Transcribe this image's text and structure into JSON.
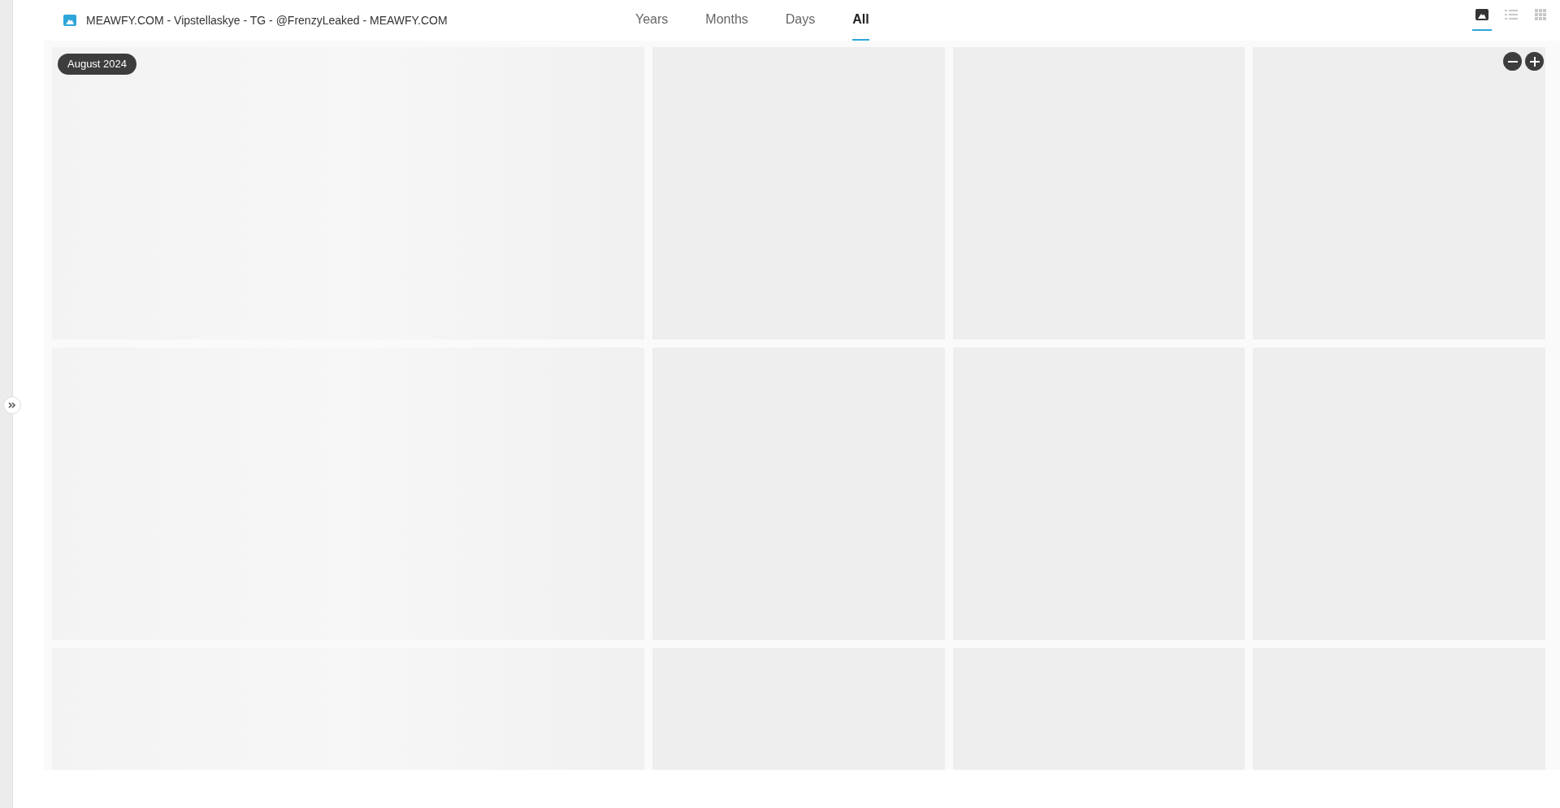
{
  "album": {
    "title": "MEAWFY.COM - Vipstellaskye - TG - @FrenzyLeaked - MEAWFY.COM"
  },
  "tabs": [
    {
      "label": "Years",
      "selected": false
    },
    {
      "label": "Months",
      "selected": false
    },
    {
      "label": "Days",
      "selected": false
    },
    {
      "label": "All",
      "selected": true
    }
  ],
  "view_modes": [
    {
      "kind": "photo",
      "selected": true
    },
    {
      "kind": "list",
      "selected": false
    },
    {
      "kind": "grid",
      "selected": false
    }
  ],
  "date_badge": "August 2024",
  "photos": [
    {
      "kind": "wide"
    },
    {
      "kind": "tile"
    },
    {
      "kind": "tile"
    },
    {
      "kind": "tile"
    },
    {
      "kind": "wide"
    },
    {
      "kind": "tile"
    },
    {
      "kind": "tile"
    },
    {
      "kind": "tile"
    },
    {
      "kind": "wide"
    },
    {
      "kind": "tile"
    },
    {
      "kind": "tile"
    },
    {
      "kind": "tile"
    }
  ]
}
